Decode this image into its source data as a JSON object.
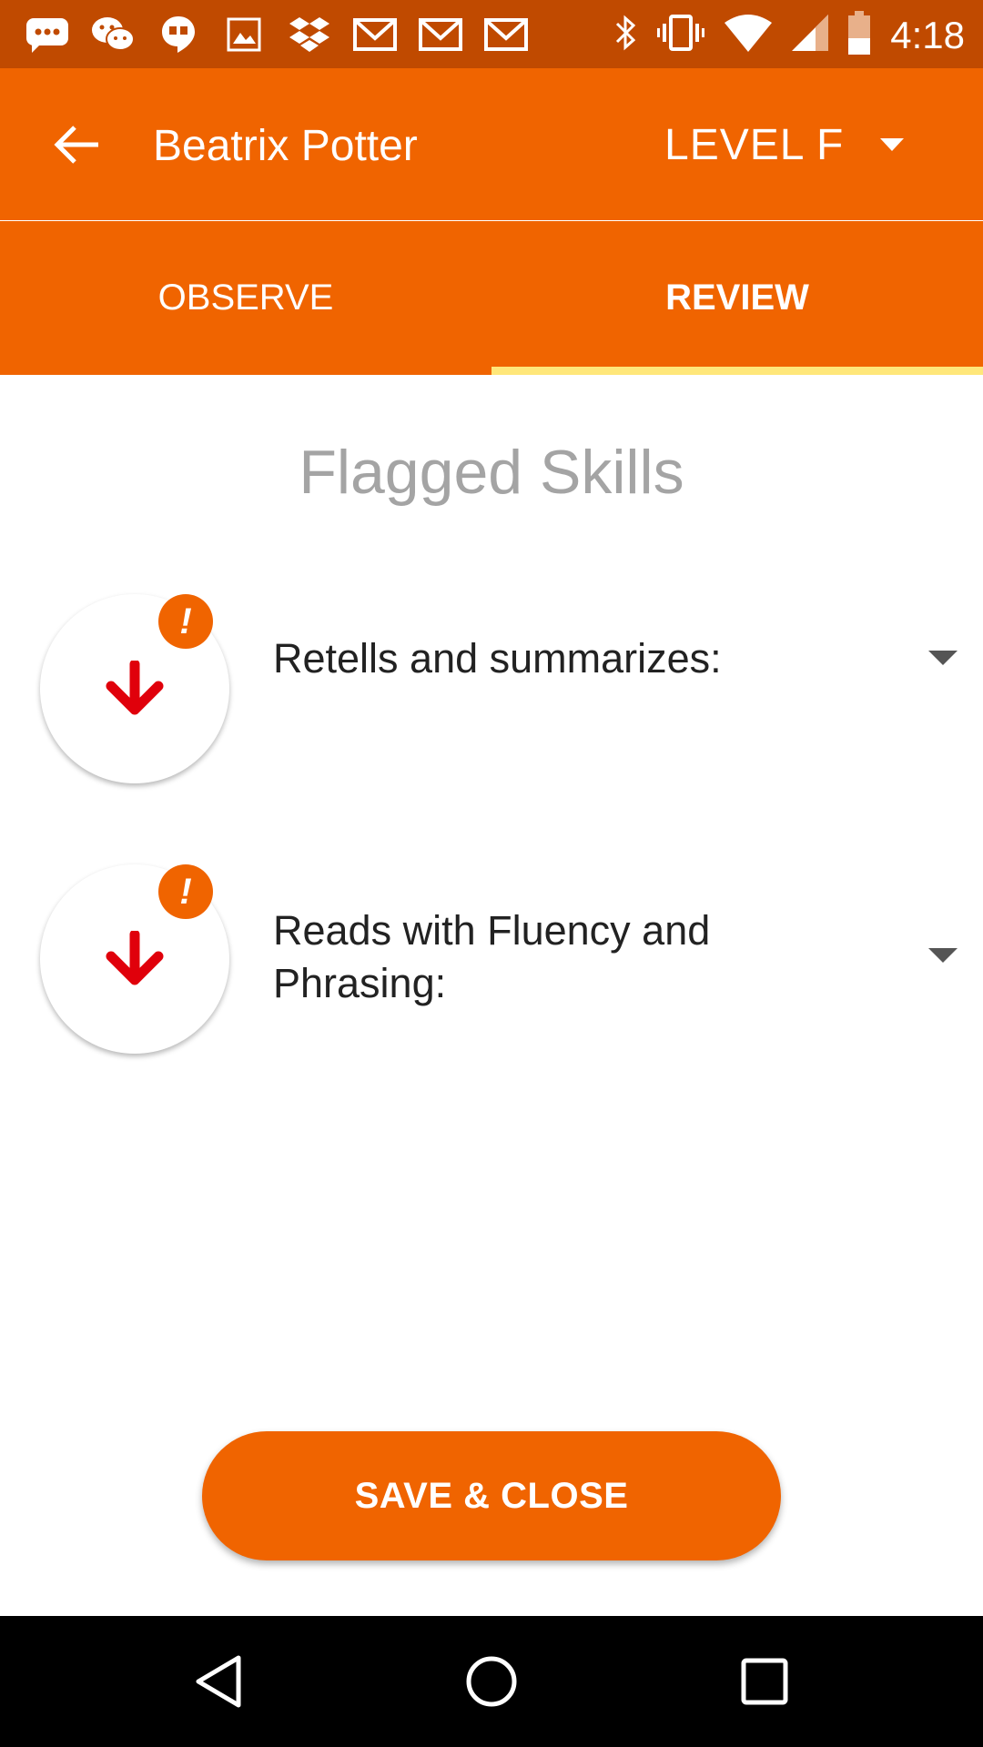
{
  "status_bar": {
    "time": "4:18",
    "left_icons": [
      "messages-icon",
      "wechat-icon",
      "hangouts-icon",
      "gallery-icon",
      "dropbox-icon",
      "gmail-icon",
      "gmail-icon",
      "gmail-icon"
    ],
    "right_icons": [
      "bluetooth-icon",
      "vibrate-icon",
      "wifi-icon",
      "cell-signal-icon",
      "battery-icon"
    ]
  },
  "toolbar": {
    "student_name": "Beatrix Potter",
    "level_label": "LEVEL F"
  },
  "tabs": [
    {
      "label": "OBSERVE",
      "active": false
    },
    {
      "label": "REVIEW",
      "active": true
    }
  ],
  "main": {
    "title": "Flagged Skills",
    "skills": [
      {
        "label": "Retells and summarizes:"
      },
      {
        "label": "Reads with Fluency and Phrasing:"
      }
    ],
    "flag_symbol": "!"
  },
  "actions": {
    "save_close_label": "SAVE & CLOSE"
  },
  "colors": {
    "primary": "#f06400",
    "status_bar": "#c04a00",
    "tab_indicator": "#ffe77a",
    "down_arrow": "#e0000b",
    "title_gray": "#a4a4a4"
  }
}
